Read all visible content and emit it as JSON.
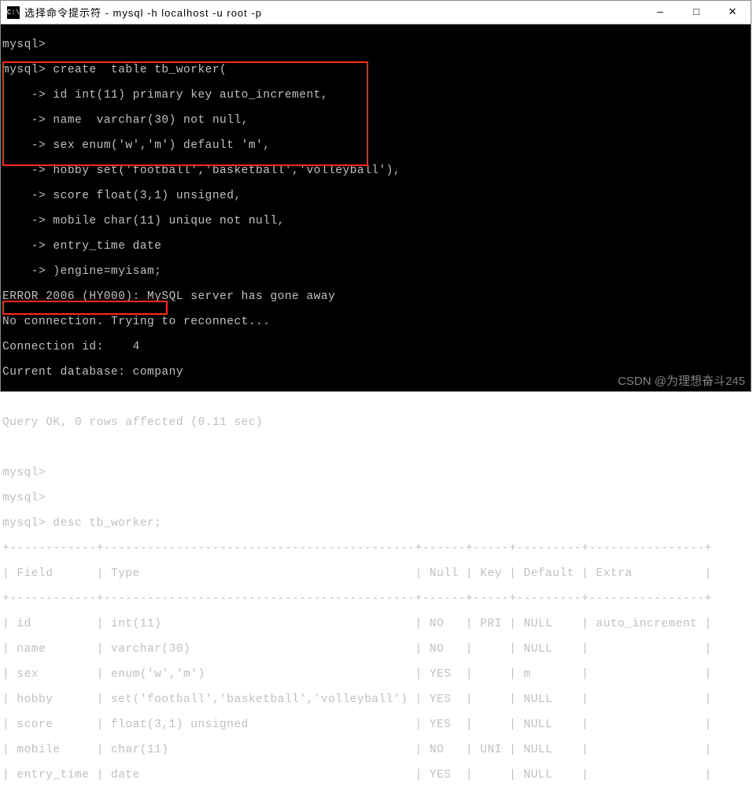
{
  "titlebar": {
    "icon_text": "C:\\",
    "title": "选择命令提示符 - mysql  -h  localhost  -u  root  -p"
  },
  "win_controls": {
    "minimize": "—",
    "maximize": "□",
    "close": "✕"
  },
  "terminal": {
    "prompt1": "mysql>",
    "create_cmd": "mysql> create  table tb_worker(",
    "create_lines": [
      "    -> id int(11) primary key auto_increment,",
      "    -> name  varchar(30) not null,",
      "    -> sex enum('w','m') default 'm',",
      "    -> hobby set('football','basketball','volleyball'),",
      "    -> score float(3,1) unsigned,",
      "    -> mobile char(11) unique not null,",
      "    -> entry_time date",
      "    -> )engine=myisam;"
    ],
    "error_line": "ERROR 2006 (HY000): MySQL server has gone away",
    "reconnect_line": "No connection. Trying to reconnect...",
    "conn_id_line": "Connection id:    4",
    "db_line": "Current database: company",
    "query_ok": "Query OK, 0 rows affected (0.11 sec)",
    "prompt2": "mysql>",
    "prompt3": "mysql>",
    "desc_cmd": "mysql> desc tb_worker;",
    "table_border_top": "+------------+-------------------------------------------+------+-----+---------+----------------+",
    "table_header": "| Field      | Type                                      | Null | Key | Default | Extra          |",
    "table_border_mid": "+------------+-------------------------------------------+------+-----+---------+----------------+",
    "rows": [
      "| id         | int(11)                                   | NO   | PRI | NULL    | auto_increment |",
      "| name       | varchar(30)                               | NO   |     | NULL    |                |",
      "| sex        | enum('w','m')                             | YES  |     | m       |                |",
      "| hobby      | set('football','basketball','volleyball') | YES  |     | NULL    |                |",
      "| score      | float(3,1) unsigned                       | YES  |     | NULL    |                |",
      "| mobile     | char(11)                                  | NO   | UNI | NULL    |                |",
      "| entry_time | date                                      | YES  |     | NULL    |                |"
    ]
  },
  "chart_data": {
    "type": "table",
    "title": "desc tb_worker",
    "columns": [
      "Field",
      "Type",
      "Null",
      "Key",
      "Default",
      "Extra"
    ],
    "rows": [
      [
        "id",
        "int(11)",
        "NO",
        "PRI",
        "NULL",
        "auto_increment"
      ],
      [
        "name",
        "varchar(30)",
        "NO",
        "",
        "NULL",
        ""
      ],
      [
        "sex",
        "enum('w','m')",
        "YES",
        "",
        "m",
        ""
      ],
      [
        "hobby",
        "set('football','basketball','volleyball')",
        "YES",
        "",
        "NULL",
        ""
      ],
      [
        "score",
        "float(3,1) unsigned",
        "YES",
        "",
        "NULL",
        ""
      ],
      [
        "mobile",
        "char(11)",
        "NO",
        "UNI",
        "NULL",
        ""
      ],
      [
        "entry_time",
        "date",
        "YES",
        "",
        "NULL",
        ""
      ]
    ]
  },
  "watermark": "CSDN @为理想奋斗245"
}
